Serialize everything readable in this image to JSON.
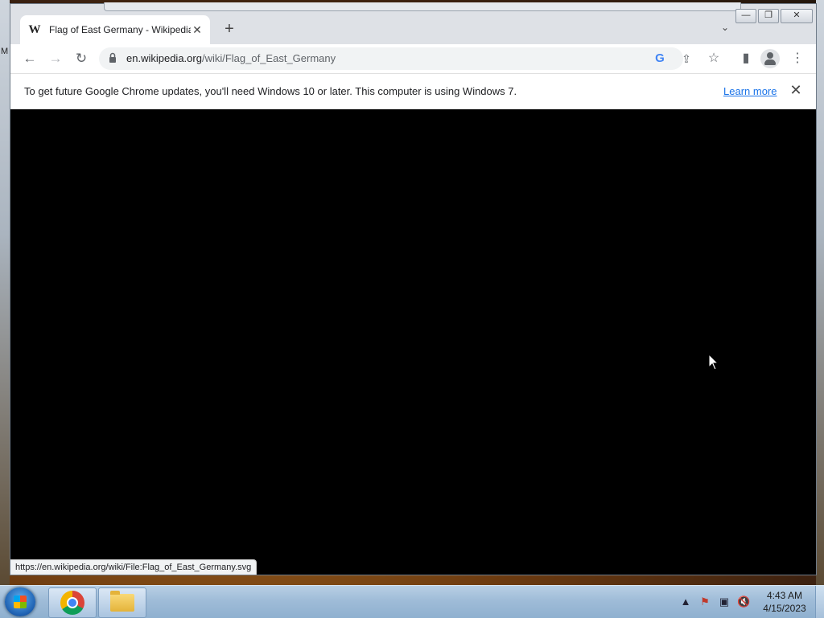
{
  "desktop": {
    "edge_text": "M"
  },
  "browser": {
    "tab": {
      "favicon": "W",
      "title": "Flag of East Germany - Wikipedia",
      "close_glyph": "✕"
    },
    "new_tab_glyph": "+",
    "tab_list_glyph": "⌄",
    "window_controls": {
      "minimize": "—",
      "maximize": "❐",
      "close": "✕"
    },
    "toolbar": {
      "back_glyph": "←",
      "forward_glyph": "→",
      "reload_glyph": "↻",
      "url_domain": "en.wikipedia.org",
      "url_path": "/wiki/Flag_of_East_Germany",
      "google_glyph": "G",
      "share_glyph": "⇪",
      "bookmark_glyph": "☆",
      "sidepanel_glyph": "▮",
      "menu_glyph": "⋮"
    },
    "infobar": {
      "message": "To get future Google Chrome updates, you'll need Windows 10 or later. This computer is using Windows 7.",
      "link": "Learn more",
      "close_glyph": "✕"
    },
    "status_url": "https://en.wikipedia.org/wiki/File:Flag_of_East_Germany.svg"
  },
  "taskbar": {
    "tray": {
      "arrow": "▲",
      "flag": "⚑",
      "network": "▣",
      "volume": "🔇"
    },
    "clock": {
      "time": "4:43 AM",
      "date": "4/15/2023"
    }
  },
  "colors": {
    "accent": "#1a73e8",
    "content_bg": "#000000",
    "taskbar": "#9fbcd8"
  }
}
